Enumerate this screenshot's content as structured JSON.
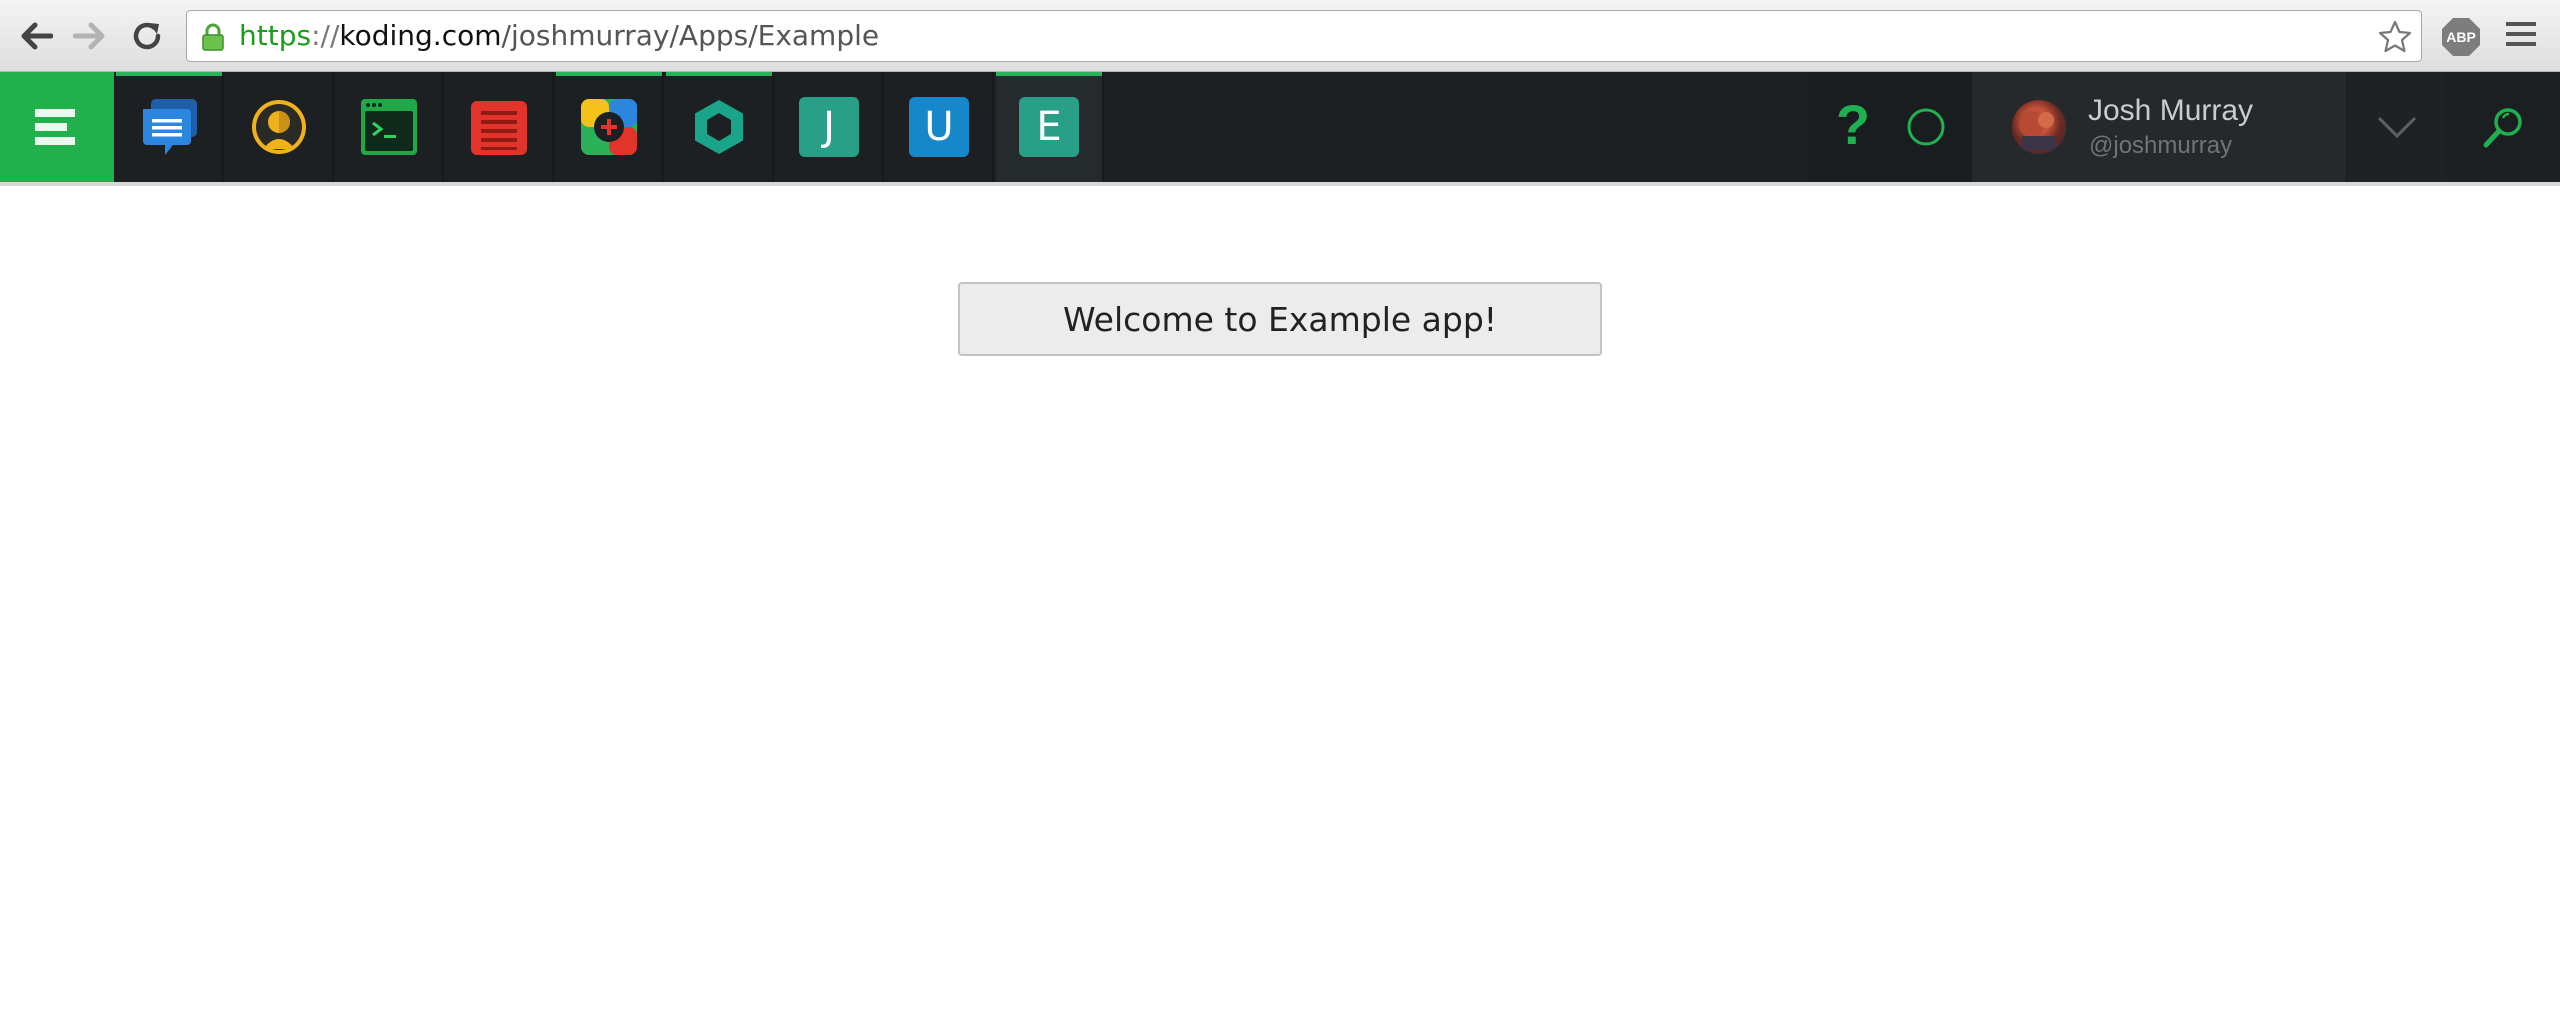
{
  "browser": {
    "url": {
      "scheme": "https",
      "separator": "://",
      "host": "koding.com",
      "path": "/joshmurray/Apps/Example"
    },
    "extension_label": "ABP"
  },
  "appbar": {
    "apps": [
      {
        "name": "activity",
        "icon": "chat-bubbles-icon",
        "color": "#2d7fd3"
      },
      {
        "name": "members",
        "icon": "member-head-icon",
        "color": "#f0b21c"
      },
      {
        "name": "terminal",
        "icon": "terminal-icon",
        "color": "#1fa84a"
      },
      {
        "name": "editor",
        "icon": "notepad-icon",
        "color": "#e2342a"
      },
      {
        "name": "apps",
        "icon": "apps-plus-icon",
        "color": "#2bb159"
      },
      {
        "name": "hexagon",
        "icon": "hexagon-icon",
        "color": "#1aa58b"
      },
      {
        "name": "j-app",
        "letter": "J",
        "color": "#2a9f88"
      },
      {
        "name": "u-app",
        "letter": "U",
        "color": "#1688c9"
      },
      {
        "name": "e-app",
        "letter": "E",
        "color": "#2a9f88"
      }
    ],
    "user": {
      "name": "Josh Murray",
      "handle": "@joshmurray"
    },
    "help_symbol": "?"
  },
  "main": {
    "welcome_text": "Welcome to Example app!"
  },
  "colors": {
    "koding_green": "#20b04c",
    "bar_dark": "#1d2022"
  }
}
